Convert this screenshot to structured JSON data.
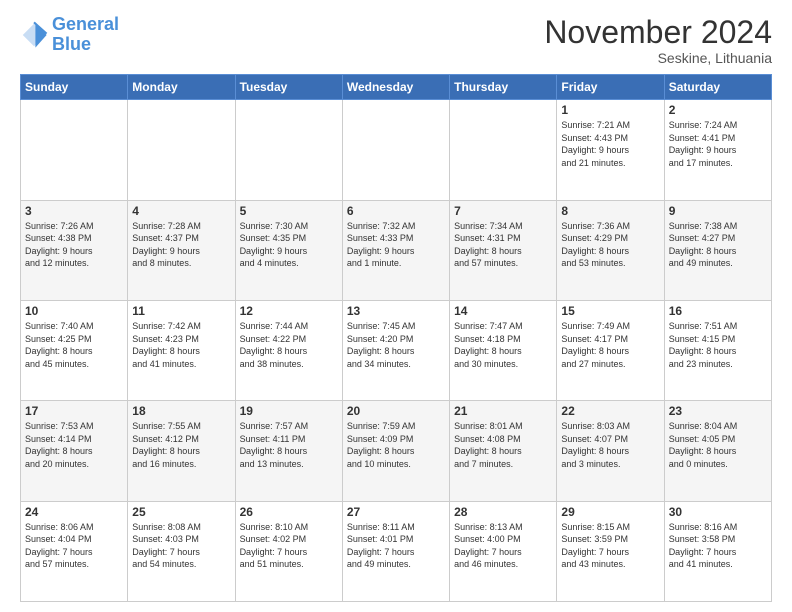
{
  "logo": {
    "line1": "General",
    "line2": "Blue"
  },
  "title": "November 2024",
  "location": "Seskine, Lithuania",
  "days_of_week": [
    "Sunday",
    "Monday",
    "Tuesday",
    "Wednesday",
    "Thursday",
    "Friday",
    "Saturday"
  ],
  "weeks": [
    [
      {
        "day": "",
        "info": ""
      },
      {
        "day": "",
        "info": ""
      },
      {
        "day": "",
        "info": ""
      },
      {
        "day": "",
        "info": ""
      },
      {
        "day": "",
        "info": ""
      },
      {
        "day": "1",
        "info": "Sunrise: 7:21 AM\nSunset: 4:43 PM\nDaylight: 9 hours\nand 21 minutes."
      },
      {
        "day": "2",
        "info": "Sunrise: 7:24 AM\nSunset: 4:41 PM\nDaylight: 9 hours\nand 17 minutes."
      }
    ],
    [
      {
        "day": "3",
        "info": "Sunrise: 7:26 AM\nSunset: 4:38 PM\nDaylight: 9 hours\nand 12 minutes."
      },
      {
        "day": "4",
        "info": "Sunrise: 7:28 AM\nSunset: 4:37 PM\nDaylight: 9 hours\nand 8 minutes."
      },
      {
        "day": "5",
        "info": "Sunrise: 7:30 AM\nSunset: 4:35 PM\nDaylight: 9 hours\nand 4 minutes."
      },
      {
        "day": "6",
        "info": "Sunrise: 7:32 AM\nSunset: 4:33 PM\nDaylight: 9 hours\nand 1 minute."
      },
      {
        "day": "7",
        "info": "Sunrise: 7:34 AM\nSunset: 4:31 PM\nDaylight: 8 hours\nand 57 minutes."
      },
      {
        "day": "8",
        "info": "Sunrise: 7:36 AM\nSunset: 4:29 PM\nDaylight: 8 hours\nand 53 minutes."
      },
      {
        "day": "9",
        "info": "Sunrise: 7:38 AM\nSunset: 4:27 PM\nDaylight: 8 hours\nand 49 minutes."
      }
    ],
    [
      {
        "day": "10",
        "info": "Sunrise: 7:40 AM\nSunset: 4:25 PM\nDaylight: 8 hours\nand 45 minutes."
      },
      {
        "day": "11",
        "info": "Sunrise: 7:42 AM\nSunset: 4:23 PM\nDaylight: 8 hours\nand 41 minutes."
      },
      {
        "day": "12",
        "info": "Sunrise: 7:44 AM\nSunset: 4:22 PM\nDaylight: 8 hours\nand 38 minutes."
      },
      {
        "day": "13",
        "info": "Sunrise: 7:45 AM\nSunset: 4:20 PM\nDaylight: 8 hours\nand 34 minutes."
      },
      {
        "day": "14",
        "info": "Sunrise: 7:47 AM\nSunset: 4:18 PM\nDaylight: 8 hours\nand 30 minutes."
      },
      {
        "day": "15",
        "info": "Sunrise: 7:49 AM\nSunset: 4:17 PM\nDaylight: 8 hours\nand 27 minutes."
      },
      {
        "day": "16",
        "info": "Sunrise: 7:51 AM\nSunset: 4:15 PM\nDaylight: 8 hours\nand 23 minutes."
      }
    ],
    [
      {
        "day": "17",
        "info": "Sunrise: 7:53 AM\nSunset: 4:14 PM\nDaylight: 8 hours\nand 20 minutes."
      },
      {
        "day": "18",
        "info": "Sunrise: 7:55 AM\nSunset: 4:12 PM\nDaylight: 8 hours\nand 16 minutes."
      },
      {
        "day": "19",
        "info": "Sunrise: 7:57 AM\nSunset: 4:11 PM\nDaylight: 8 hours\nand 13 minutes."
      },
      {
        "day": "20",
        "info": "Sunrise: 7:59 AM\nSunset: 4:09 PM\nDaylight: 8 hours\nand 10 minutes."
      },
      {
        "day": "21",
        "info": "Sunrise: 8:01 AM\nSunset: 4:08 PM\nDaylight: 8 hours\nand 7 minutes."
      },
      {
        "day": "22",
        "info": "Sunrise: 8:03 AM\nSunset: 4:07 PM\nDaylight: 8 hours\nand 3 minutes."
      },
      {
        "day": "23",
        "info": "Sunrise: 8:04 AM\nSunset: 4:05 PM\nDaylight: 8 hours\nand 0 minutes."
      }
    ],
    [
      {
        "day": "24",
        "info": "Sunrise: 8:06 AM\nSunset: 4:04 PM\nDaylight: 7 hours\nand 57 minutes."
      },
      {
        "day": "25",
        "info": "Sunrise: 8:08 AM\nSunset: 4:03 PM\nDaylight: 7 hours\nand 54 minutes."
      },
      {
        "day": "26",
        "info": "Sunrise: 8:10 AM\nSunset: 4:02 PM\nDaylight: 7 hours\nand 51 minutes."
      },
      {
        "day": "27",
        "info": "Sunrise: 8:11 AM\nSunset: 4:01 PM\nDaylight: 7 hours\nand 49 minutes."
      },
      {
        "day": "28",
        "info": "Sunrise: 8:13 AM\nSunset: 4:00 PM\nDaylight: 7 hours\nand 46 minutes."
      },
      {
        "day": "29",
        "info": "Sunrise: 8:15 AM\nSunset: 3:59 PM\nDaylight: 7 hours\nand 43 minutes."
      },
      {
        "day": "30",
        "info": "Sunrise: 8:16 AM\nSunset: 3:58 PM\nDaylight: 7 hours\nand 41 minutes."
      }
    ]
  ]
}
